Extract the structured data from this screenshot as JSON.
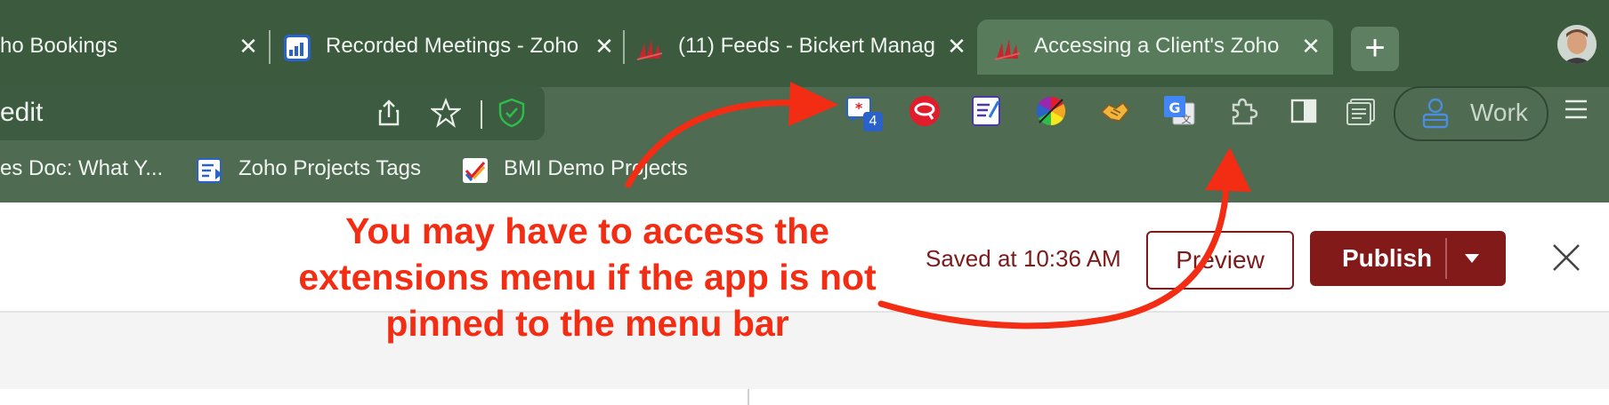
{
  "tabs": [
    {
      "title": "ho Bookings",
      "active": false
    },
    {
      "title": "Recorded Meetings - Zoho",
      "active": false
    },
    {
      "title": "(11) Feeds - Bickert Manag",
      "active": false
    },
    {
      "title": "Accessing a Client's Zoho",
      "active": true
    }
  ],
  "tab_close_glyph": "✕",
  "new_tab_glyph": "+",
  "address_bar": {
    "text": "edit"
  },
  "extensions": {
    "badge_count": "4",
    "icons": [
      "feedback-extension-icon",
      "lasso-extension-icon",
      "notes-extension-icon",
      "color-picker-extension-icon",
      "handshake-extension-icon",
      "google-translate-extension-icon",
      "extensions-puzzle-icon",
      "sidebar-icon",
      "reading-list-icon"
    ]
  },
  "profile_container": {
    "label": "Work"
  },
  "bookmarks": [
    {
      "label": "es Doc: What Y..."
    },
    {
      "label": "Zoho Projects Tags"
    },
    {
      "label": "BMI Demo Projects"
    }
  ],
  "editor": {
    "saved_status": "Saved at 10:36 AM",
    "preview_label": "Preview",
    "publish_label": "Publish"
  },
  "annotation": {
    "line1": "You may have to access the",
    "line2": "extensions menu if the app is not",
    "line3": "pinned to the menu bar",
    "color": "#f22d14"
  },
  "colors": {
    "browser_chrome": "#4f6b52",
    "tabstrip": "#3b5a3e",
    "publish_button": "#821a1a",
    "accent_text": "#7a1b1b"
  }
}
